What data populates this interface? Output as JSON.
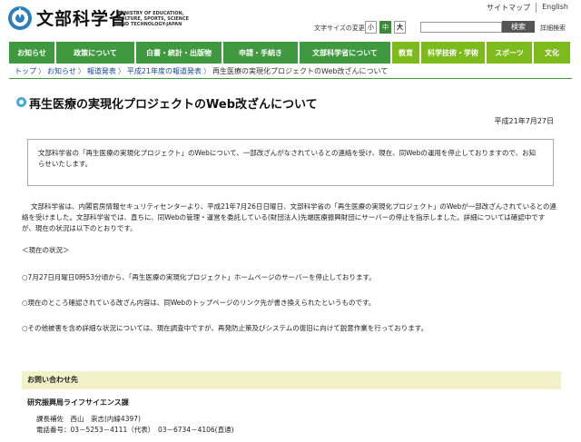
{
  "header": {
    "logo_text": "文部科学省",
    "logo_en": "MINISTRY OF EDUCATION, CULTURE, SPORTS, SCIENCE AND TECHNOLOGY-JAPAN",
    "util_links": [
      "サイトマップ",
      "English"
    ],
    "font_size_label": "文字サイズの変更",
    "font_sizes": [
      "小",
      "中",
      "大"
    ],
    "search_placeholder": "",
    "search_button": "検索",
    "advanced_search": "詳細検索"
  },
  "nav": {
    "items": [
      "お知らせ",
      "政策について",
      "白書・統計・出版物",
      "申請・手続き",
      "文部科学省について",
      "教育",
      "科学技術・学術",
      "スポーツ",
      "文化"
    ]
  },
  "breadcrumb": [
    "トップ",
    "お知らせ",
    "報道発表",
    "平成21年度の報道発表",
    "再生医療の実現化プロジェクトのWeb改ざんについて"
  ],
  "page": {
    "title": "再生医療の実現化プロジェクトのWeb改ざんについて",
    "date": "平成21年7月27日",
    "notice": "文部科学省の「再生医療の実現化プロジェクト」のWebについて、一部改ざんがなされているとの連絡を受け、現在、同Webの運用を停止しておりますので、お知らせいたします。",
    "main_paragraph": "文部科学省は、内閣官房情報セキュリティセンターより、平成21年7月26日日曜日、文部科学省の「再生医療の実現化プロジェクト」のWebが一部改ざんされているとの連絡を受けました。文部科学省では、直ちに、同Webの管理・運営を委託している(財団法人)先端医療振興財団にサーバーの停止を指示しました。詳細については確認中ですが、現在の状況は以下のとおりです。",
    "current_heading": "＜現在の状況＞",
    "items": [
      "○7月27日月曜日0時53分頃から、「再生医療の実現化プロジェクト」ホームページのサーバーを停止しております。",
      "○現在のところ確認されている改ざん内容は、同Webのトップページのリンク先が書き換えられたというものです。",
      "○その他被害を含め詳細な状況については、現在調査中ですが、再発防止策及びシステムの復旧に向けて鋭意作業を行っております。"
    ]
  },
  "contact": {
    "heading": "お問い合わせ先",
    "department": "研究振興局ライフサイエンス課",
    "line1": "課長補佐　西山　崇志(内線4397)",
    "line2": "電話番号：03－5253－4111（代表）　03－6734－4106(直通)"
  },
  "colors": {
    "nav_green": "#3f9a3f",
    "nav_lime": "#7dba1c",
    "contact_bg": "#f3f1c8"
  }
}
